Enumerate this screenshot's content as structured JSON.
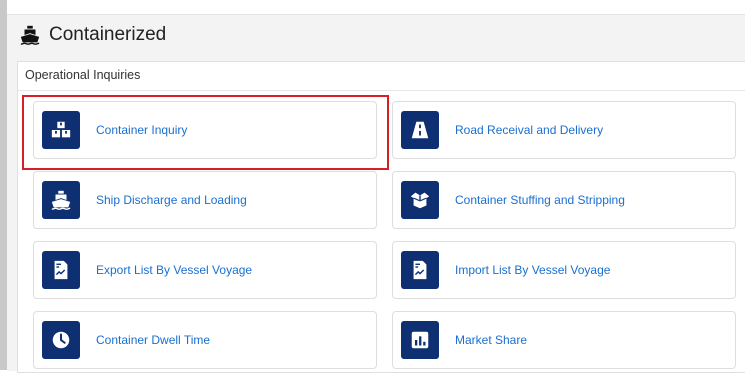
{
  "panel": {
    "title": "Containerized",
    "icon": "ship-icon"
  },
  "section": {
    "title": "Operational Inquiries"
  },
  "cards": [
    {
      "label": "Container Inquiry",
      "icon": "containers-icon"
    },
    {
      "label": "Road Receival and Delivery",
      "icon": "road-icon"
    },
    {
      "label": "Ship Discharge and Loading",
      "icon": "ship-icon"
    },
    {
      "label": "Container Stuffing and Stripping",
      "icon": "open-box-icon"
    },
    {
      "label": "Export List By Vessel Voyage",
      "icon": "document-icon"
    },
    {
      "label": "Import List By Vessel Voyage",
      "icon": "document-icon"
    },
    {
      "label": "Container Dwell Time",
      "icon": "clock-icon"
    },
    {
      "label": "Market Share",
      "icon": "bar-chart-icon"
    }
  ],
  "colors": {
    "icon_bg": "#0f2f73",
    "link": "#1a6fd1",
    "highlight": "#d61f26"
  }
}
